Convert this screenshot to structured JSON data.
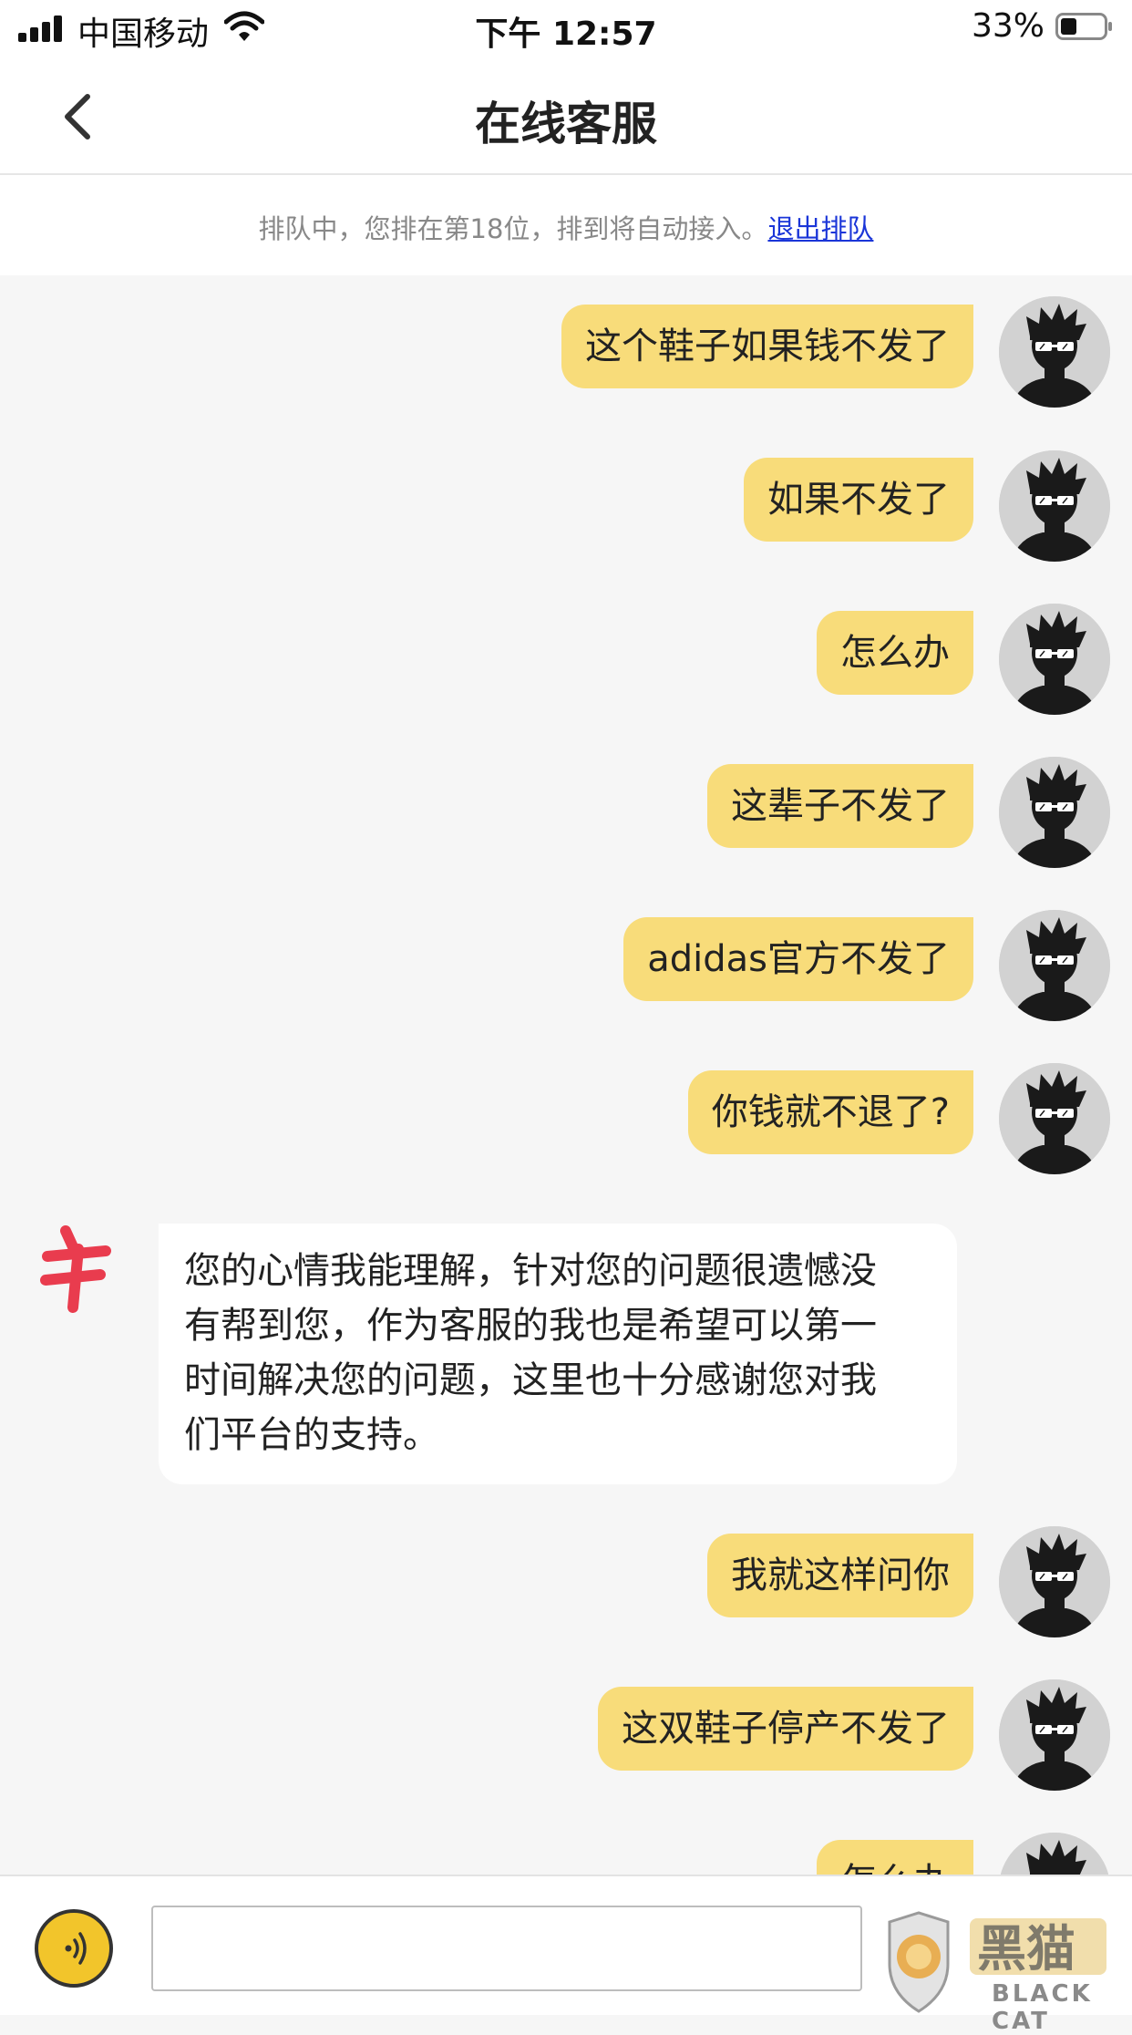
{
  "status_bar": {
    "carrier": "中国移动",
    "time": "下午 12:57",
    "battery": "33%"
  },
  "header": {
    "title": "在线客服",
    "back_icon": "chevron-left-icon"
  },
  "queue_notice": {
    "text": "排队中，您排在第18位，排到将自动接入。",
    "exit_link": "退出排队"
  },
  "messages": [
    {
      "from": "user",
      "text": "这个鞋子如果钱不发了"
    },
    {
      "from": "user",
      "text": "如果不发了"
    },
    {
      "from": "user",
      "text": "怎么办"
    },
    {
      "from": "user",
      "text": "这辈子不发了"
    },
    {
      "from": "user",
      "text": "adidas官方不发了"
    },
    {
      "from": "user",
      "text": "你钱就不退了?"
    },
    {
      "from": "agent",
      "lines": [
        "您的心情我能理解，针对您的问题很遗憾没",
        "有帮到您，作为客服的我也是希望可以第一",
        "时间解决您的问题，这里也十分感谢您对我",
        "们平台的支持。"
      ]
    },
    {
      "from": "user",
      "text": "我就这样问你"
    },
    {
      "from": "user",
      "text": "这双鞋子停产不发了"
    },
    {
      "from": "user",
      "text": "怎么办"
    }
  ],
  "input_bar": {
    "voice_icon": "voice-icon",
    "input_value": "",
    "input_placeholder": ""
  },
  "watermark": {
    "text": "BLACK CAT"
  },
  "colors": {
    "user_bubble": "#f8dc7a",
    "agent_bubble": "#ffffff",
    "background": "#f6f6f6",
    "link": "#1a35d8",
    "voice_button": "#f2c52b",
    "agent_logo": "#e8283c"
  }
}
